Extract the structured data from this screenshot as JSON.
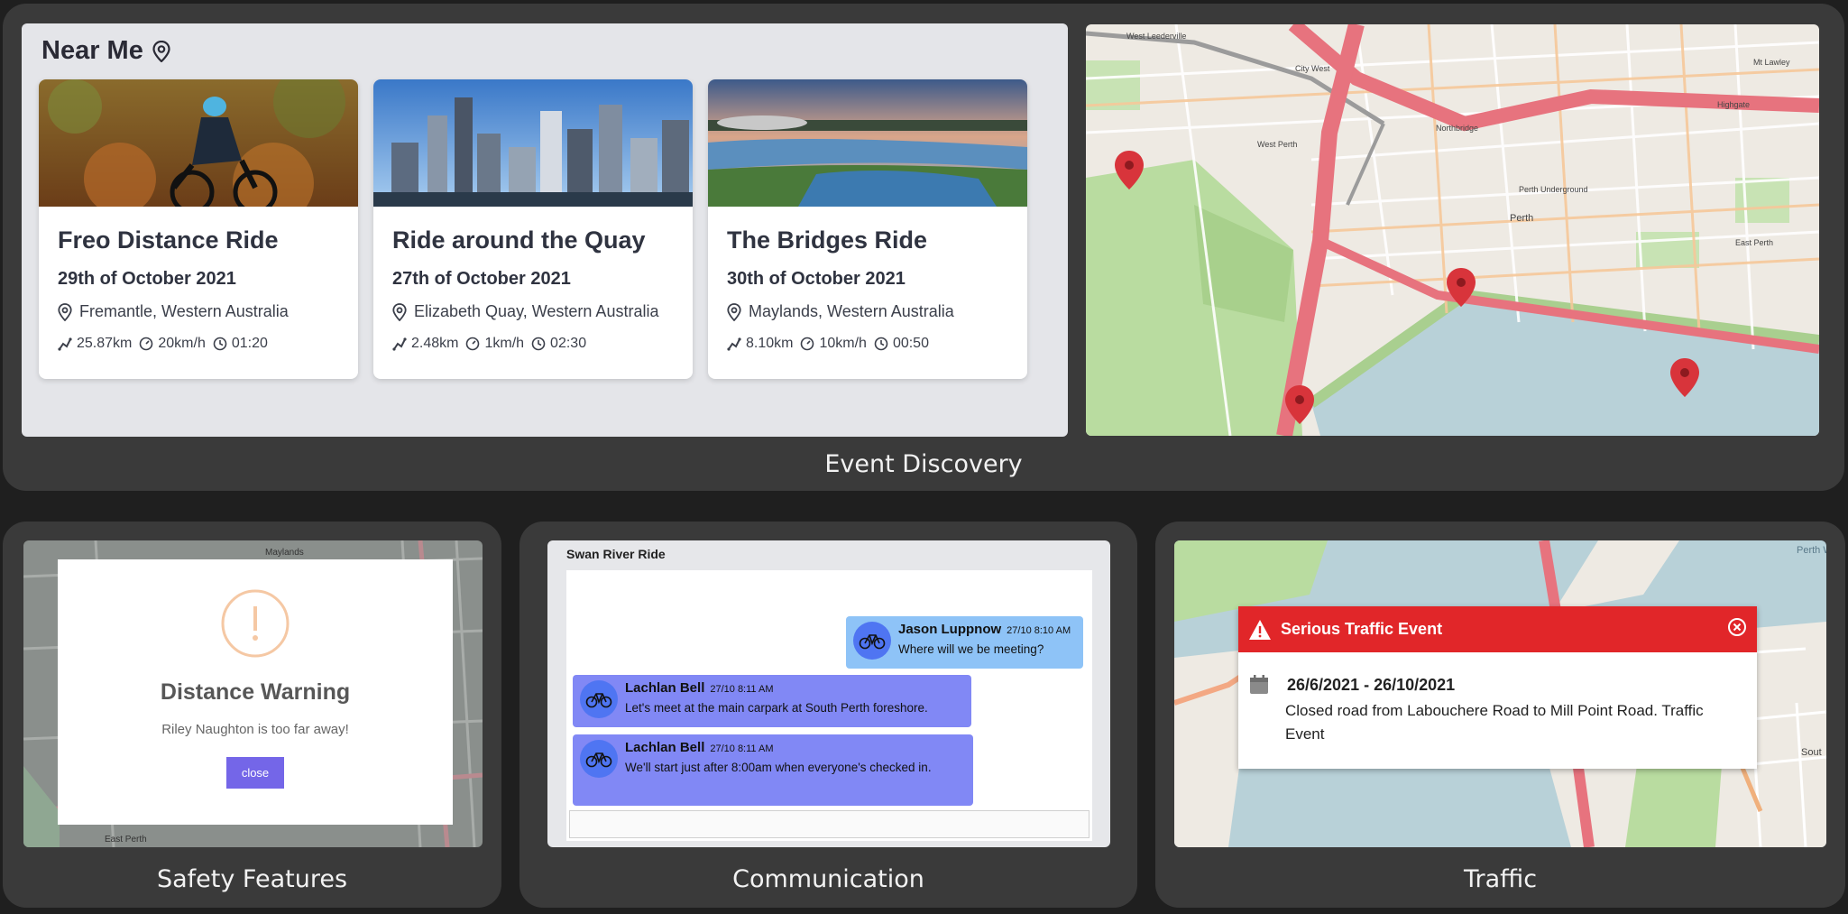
{
  "top": {
    "near_me_title": "Near Me",
    "caption": "Event Discovery",
    "events": [
      {
        "title": "Freo Distance Ride",
        "date": "29th of October 2021",
        "location": "Fremantle, Western Australia",
        "distance": "25.87km",
        "speed": "20km/h",
        "duration": "01:20"
      },
      {
        "title": "Ride around the Quay",
        "date": "27th of October 2021",
        "location": "Elizabeth Quay, Western Australia",
        "distance": "2.48km",
        "speed": "1km/h",
        "duration": "02:30"
      },
      {
        "title": "The Bridges Ride",
        "date": "30th of October 2021",
        "location": "Maylands, Western Australia",
        "distance": "8.10km",
        "speed": "10km/h",
        "duration": "00:50"
      }
    ],
    "map_labels": [
      "West Leederville",
      "City West",
      "Northbridge",
      "West Perth",
      "Perth",
      "East Perth",
      "Mt Lawley",
      "Highgate",
      "Perth Underground"
    ]
  },
  "safety": {
    "caption": "Safety Features",
    "modal_title": "Distance Warning",
    "modal_message": "Riley Naughton is too far away!",
    "close_label": "close",
    "map_labels": [
      "Maylands",
      "East Perth"
    ]
  },
  "communication": {
    "caption": "Communication",
    "chat_title": "Swan River Ride",
    "messages": [
      {
        "name": "Jason Luppnow",
        "time": "27/10 8:10 AM",
        "text": "Where will we be meeting?"
      },
      {
        "name": "Lachlan Bell",
        "time": "27/10 8:11 AM",
        "text": "Let's meet at the main carpark at South Perth foreshore."
      },
      {
        "name": "Lachlan Bell",
        "time": "27/10 8:11 AM",
        "text": "We'll start just after 8:00am when everyone's checked in."
      }
    ]
  },
  "traffic": {
    "caption": "Traffic",
    "alert_title": "Serious Traffic Event",
    "alert_dates": "26/6/2021 - 26/10/2021",
    "alert_desc": "Closed road from Labouchere Road to Mill Point Road. Traffic Event",
    "map_labels": [
      "Perth W",
      "Sout"
    ]
  },
  "colors": {
    "panel": "#3a3a3a",
    "accent_purple": "#7466e8",
    "alert_red": "#e12629",
    "pin_red": "#d8343b",
    "chat_self": "#8ec3f7",
    "chat_other": "#8188f5"
  }
}
